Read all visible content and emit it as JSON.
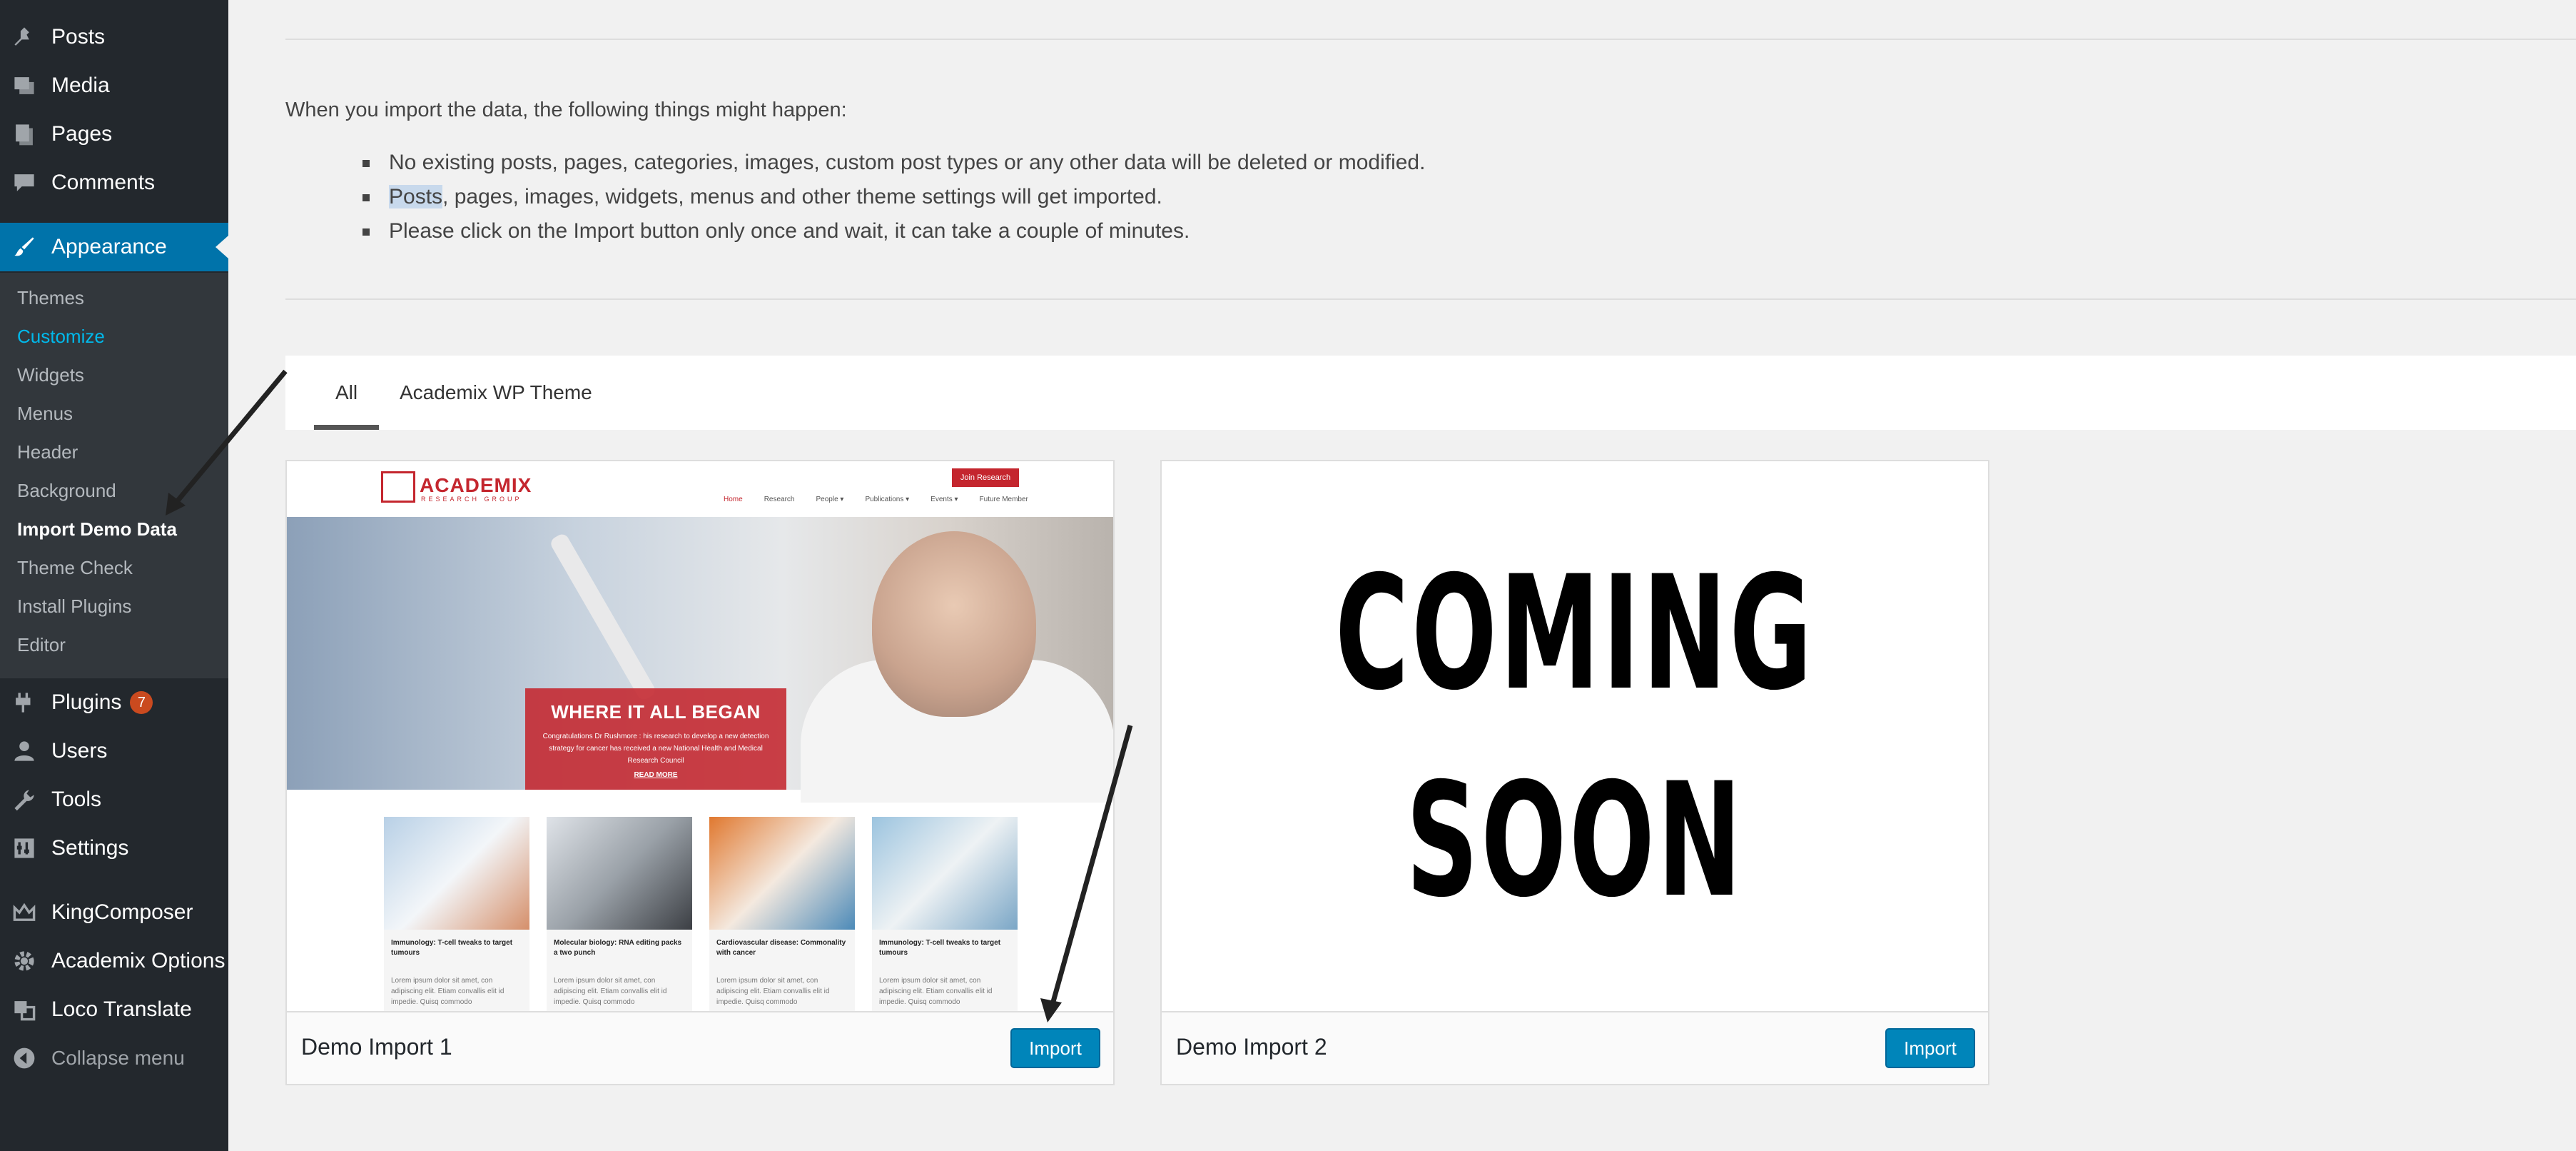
{
  "sidebar": {
    "top_items": [
      {
        "label": "Posts",
        "icon": "pin-icon"
      },
      {
        "label": "Media",
        "icon": "media-icon"
      },
      {
        "label": "Pages",
        "icon": "pages-icon"
      },
      {
        "label": "Comments",
        "icon": "comments-icon"
      }
    ],
    "appearance": {
      "label": "Appearance",
      "icon": "paintbrush-icon"
    },
    "submenu": [
      "Themes",
      "Customize",
      "Widgets",
      "Menus",
      "Header",
      "Background",
      "Import Demo Data",
      "Theme Check",
      "Install Plugins",
      "Editor"
    ],
    "bottom_items": [
      {
        "label": "Plugins",
        "icon": "plugins-icon",
        "badge": "7"
      },
      {
        "label": "Users",
        "icon": "users-icon"
      },
      {
        "label": "Tools",
        "icon": "wrench-icon"
      },
      {
        "label": "Settings",
        "icon": "settings-icon"
      },
      {
        "label": "KingComposer",
        "icon": "crown-icon"
      },
      {
        "label": "Academix Options",
        "icon": "gear-icon"
      },
      {
        "label": "Loco Translate",
        "icon": "translate-icon"
      }
    ],
    "collapse_label": "Collapse menu",
    "colors": {
      "bg": "#23282d",
      "submenu_bg": "#32373c",
      "active": "#0073aa",
      "badge": "#ca4a1f"
    }
  },
  "main": {
    "intro": "When you import the data, the following things might happen:",
    "bullets": [
      {
        "highlight": "Posts",
        "rest": ", pages, images, widgets, menus and other theme settings will get imported."
      }
    ],
    "bullet1": "No existing posts, pages, categories, images, custom post types or any other data will be deleted or modified.",
    "bullet3": "Please click on the Import button only once and wait, it can take a couple of minutes.",
    "tabs": [
      "All",
      "Academix WP Theme"
    ],
    "cards": [
      {
        "title": "Demo Import 1",
        "button": "Import"
      },
      {
        "title": "Demo Import 2",
        "button": "Import"
      }
    ],
    "accent": "#0085ba"
  },
  "preview1": {
    "logo": "ACADEMIX",
    "logo_sub": "RESEARCH GROUP",
    "join": "Join Research",
    "nav": [
      "Home",
      "Research",
      "People ▾",
      "Publications ▾",
      "Events ▾",
      "Future Member"
    ],
    "hero_title": "WHERE IT ALL BEGAN",
    "hero_text": "Congratulations Dr Rushmore : his research to develop a new detection strategy for cancer has received a new National Health and Medical Research Council",
    "hero_more": "READ MORE",
    "thumbs": [
      {
        "title": "Immunology: T-cell tweaks to target tumours",
        "text": "Lorem ipsum dolor sit amet, con adipiscing elit. Etiam convallis elit id impedie. Quisq commodo"
      },
      {
        "title": "Molecular biology: RNA editing packs a two punch",
        "text": "Lorem ipsum dolor sit amet, con adipiscing elit. Etiam convallis elit id impedie. Quisq commodo"
      },
      {
        "title": "Cardiovascular disease: Commonality with cancer",
        "text": "Lorem ipsum dolor sit amet, con adipiscing elit. Etiam convallis elit id impedie. Quisq commodo"
      },
      {
        "title": "Immunology: T-cell tweaks to target tumours",
        "text": "Lorem ipsum dolor sit amet, con adipiscing elit. Etiam convallis elit id impedie. Quisq commodo"
      }
    ]
  },
  "preview2": {
    "line1": "COMING",
    "line2": "SOON"
  }
}
